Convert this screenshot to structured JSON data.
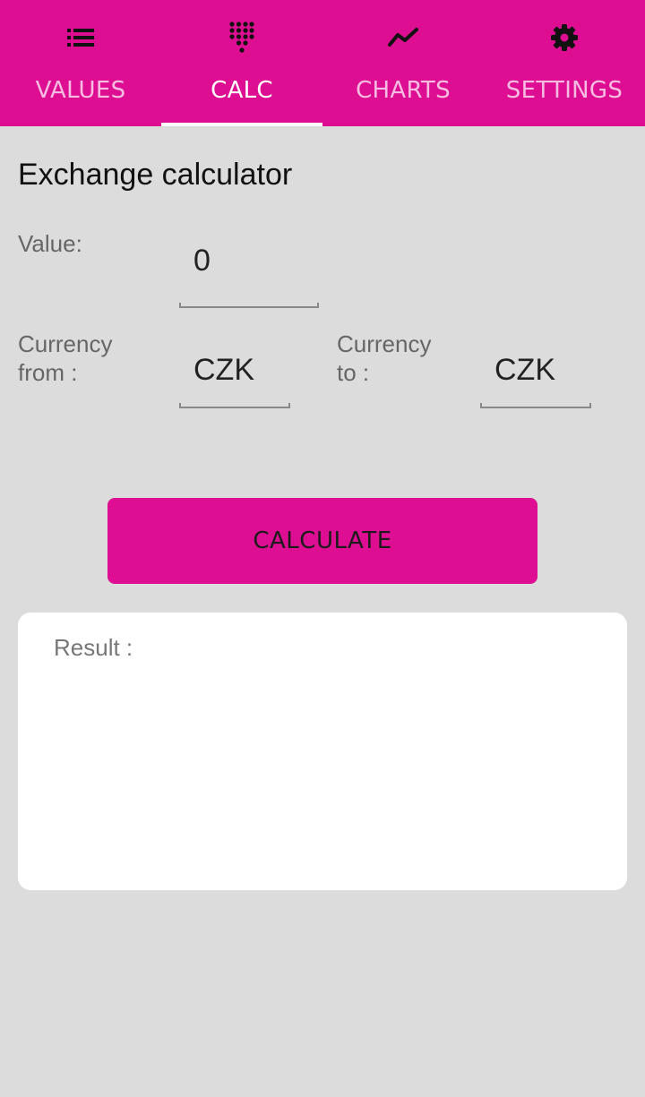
{
  "tabs": [
    {
      "label": "VALUES",
      "icon": "list-icon",
      "active": false
    },
    {
      "label": "CALC",
      "icon": "dialpad-icon",
      "active": true
    },
    {
      "label": "CHARTS",
      "icon": "chart-line-icon",
      "active": false
    },
    {
      "label": "SETTINGS",
      "icon": "gear-icon",
      "active": false
    }
  ],
  "colors": {
    "accent": "#dd0e92",
    "background": "#dcdcdc",
    "card": "#ffffff"
  },
  "calculator": {
    "title": "Exchange calculator",
    "value_label": "Value:",
    "value": "0",
    "currency_from_label_line1": "Currency",
    "currency_from_label_line2": "from :",
    "currency_from": "CZK",
    "currency_to_label_line1": "Currency",
    "currency_to_label_line2": "to :",
    "currency_to": "CZK",
    "calculate_label": "CALCULATE",
    "result_label": "Result :"
  }
}
